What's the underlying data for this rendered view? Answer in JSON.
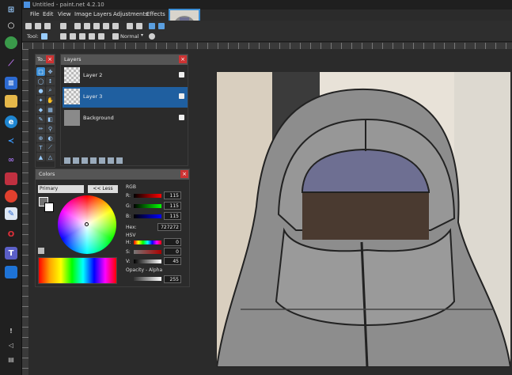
{
  "window": {
    "title": "Untitled - paint.net 4.2.10"
  },
  "menu": [
    "File",
    "Edit",
    "View",
    "Image",
    "Layers",
    "Adjustments",
    "Effects"
  ],
  "toolbar": {
    "tool_label": "Tool:",
    "blend_mode": "Normal"
  },
  "tools_panel": {
    "title": "To..."
  },
  "layers_panel": {
    "title": "Layers",
    "layers": [
      {
        "name": "Layer 2",
        "selected": false,
        "visible": true
      },
      {
        "name": "Layer 3",
        "selected": true,
        "visible": true
      },
      {
        "name": "Background",
        "selected": false,
        "visible": true
      }
    ]
  },
  "colors_panel": {
    "title": "Colors",
    "mode": "Primary",
    "less_button": "<< Less",
    "rgb_label": "RGB",
    "r_label": "R:",
    "r": "115",
    "g_label": "G:",
    "g": "115",
    "b_label": "B:",
    "b": "115",
    "hex_label": "Hex:",
    "hex": "727272",
    "hsv_label": "HSV",
    "h_label": "H:",
    "h": "0",
    "s_label": "S:",
    "s": "0",
    "v_label": "V:",
    "v": "45",
    "opacity_label": "Opacity - Alpha",
    "opacity": "255"
  },
  "colors": {
    "accent": "#3d8fd6",
    "selected_layer": "#1f5fa0",
    "hood": "#9a9a9a",
    "visor": "#6e6f92"
  }
}
